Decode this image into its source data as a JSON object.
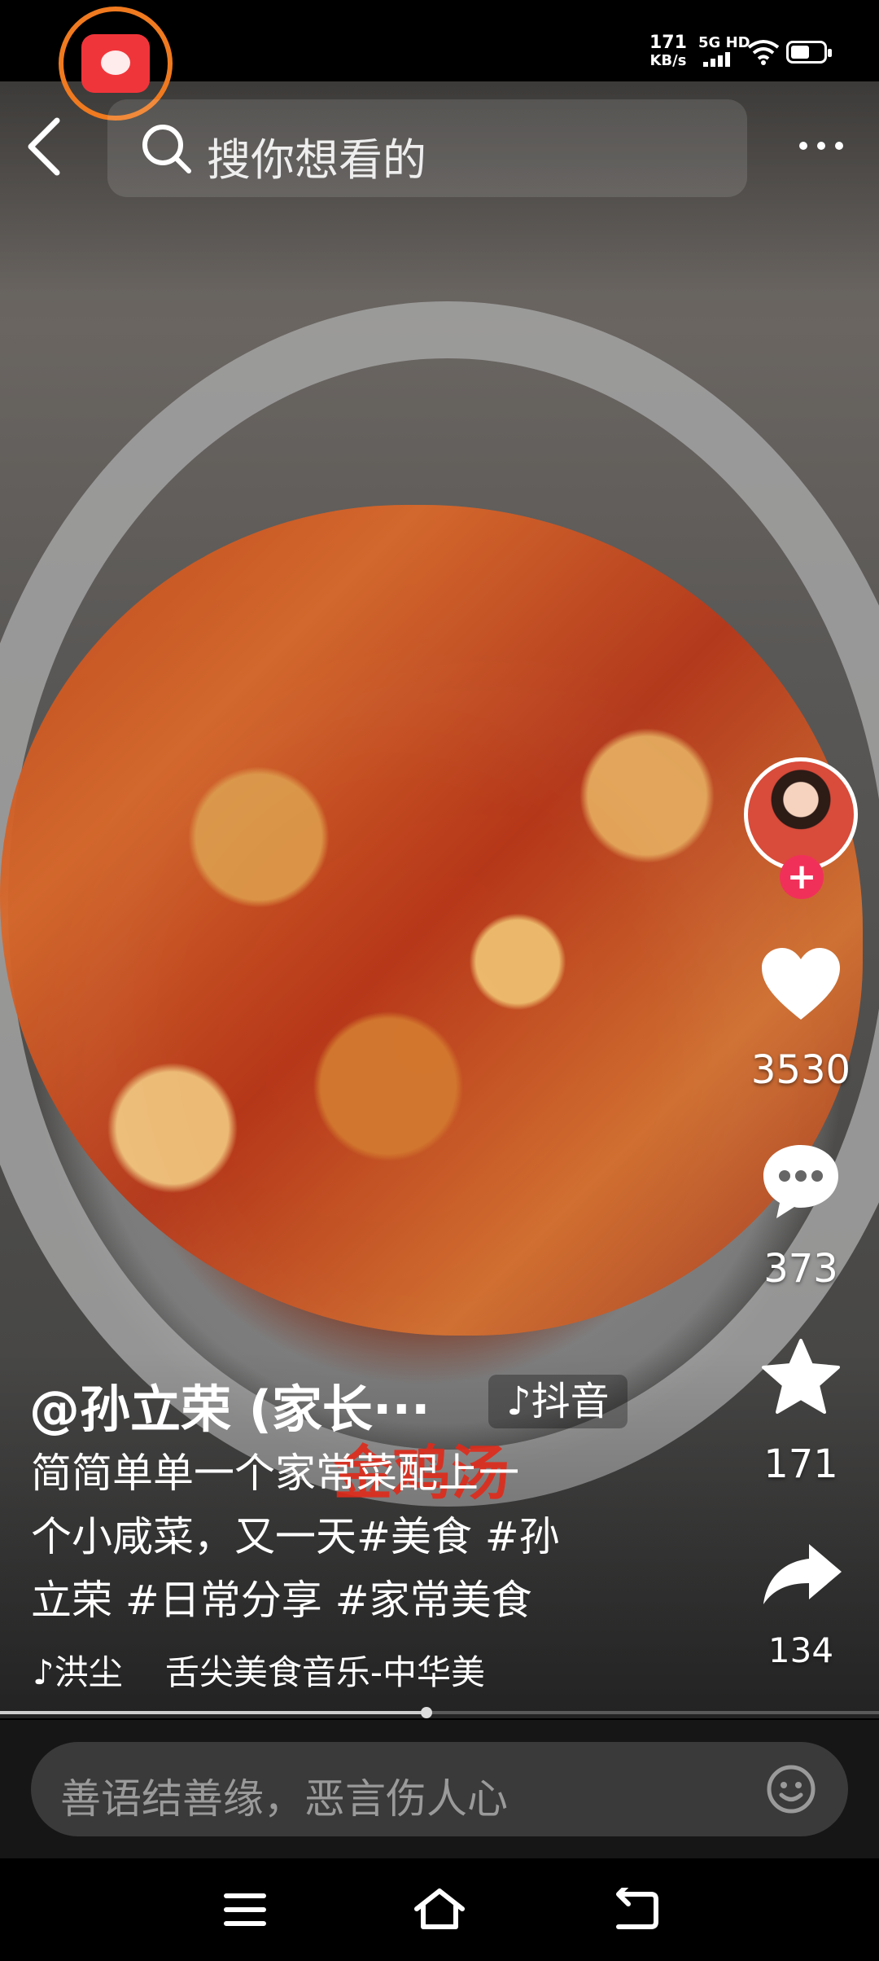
{
  "status_bar": {
    "net_speed_value": "171",
    "net_speed_unit": "KB/s",
    "signal_label": "5G HD"
  },
  "search": {
    "placeholder": "搜你想看的"
  },
  "video": {
    "overlay_caption": "金鸡汤"
  },
  "actions": {
    "likes": "3530",
    "comments": "373",
    "favorites": "171",
    "shares": "134",
    "follow_symbol": "+"
  },
  "post": {
    "author": "@孙立荣 (家长···",
    "platform_tag": "♪抖音",
    "description_lines": [
      "简简单单一个家常菜配上一",
      "个小咸菜，又一天#美食 #孙",
      "立荣 #日常分享 #家常美食"
    ],
    "music_artist": "♪洪尘",
    "music_title": "舌尖美食音乐-中华美"
  },
  "playback": {
    "progress_fraction": 0.485
  },
  "comment": {
    "placeholder": "善语结善缘，恶言伤人心"
  },
  "colors": {
    "accent_pink": "#f1305a",
    "live_ring": "#f07a1f",
    "live_red": "#f0353a"
  }
}
